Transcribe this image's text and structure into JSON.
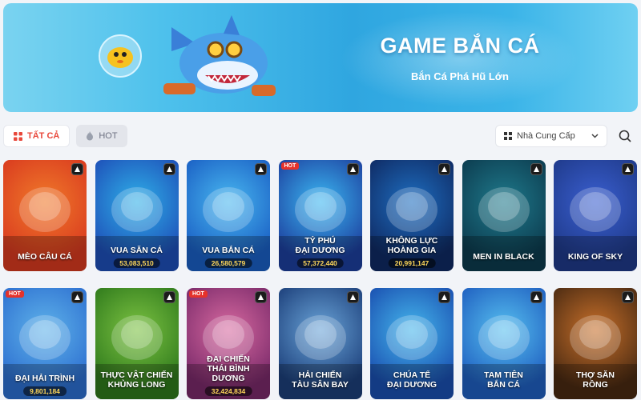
{
  "banner": {
    "title": "GAME BẮN CÁ",
    "subtitle": "Bắn Cá Phá Hũ Lớn"
  },
  "filters": [
    {
      "label": "TẤT CẢ",
      "active": true,
      "icon": "grid-icon"
    },
    {
      "label": "HOT",
      "active": false,
      "icon": "flame-icon"
    }
  ],
  "provider": {
    "label": "Nhà Cung Cấp",
    "icon": "grid-icon"
  },
  "search": {
    "icon": "search-icon"
  },
  "colors": {
    "accent": "#e8473a",
    "jackpot": "#ffd85a",
    "hot_badge": "#e5322b"
  },
  "games": [
    {
      "name": "MÈO CÂU CÁ",
      "amount": "",
      "hot": false,
      "c1": "#d93a1f",
      "c2": "#f07a2a"
    },
    {
      "name": "VUA SĂN CÁ",
      "amount": "53,083,510",
      "hot": false,
      "c1": "#1e4fb8",
      "c2": "#2fb0e8"
    },
    {
      "name": "VUA BẮN CÁ",
      "amount": "26,580,579",
      "hot": false,
      "c1": "#1a5fc4",
      "c2": "#49b8f0"
    },
    {
      "name": "TỶ PHÚ\nĐẠI DƯƠNG",
      "amount": "57,372,440",
      "hot": true,
      "c1": "#1d3f9e",
      "c2": "#3bb8f2"
    },
    {
      "name": "KHÔNG LỰC\nHOÀNG GIA",
      "amount": "20,991,147",
      "hot": false,
      "c1": "#0f2a63",
      "c2": "#1e6ec0"
    },
    {
      "name": "MEN IN BLACK",
      "amount": "",
      "hot": false,
      "c1": "#0c3b4e",
      "c2": "#1f7a8c"
    },
    {
      "name": "KING OF SKY",
      "amount": "",
      "hot": false,
      "c1": "#1f3a8a",
      "c2": "#3a5fd0"
    },
    {
      "name": "ĐẠI HẢI TRÌNH",
      "amount": "9,801,184",
      "hot": true,
      "c1": "#2d6fd0",
      "c2": "#5fb3ea"
    },
    {
      "name": "THỰC VẬT CHIẾN\nKHỦNG LONG",
      "amount": "",
      "hot": false,
      "c1": "#2f7a1c",
      "c2": "#7cc242"
    },
    {
      "name": "ĐẠI CHIẾN\nTHÁI BÌNH DƯƠNG",
      "amount": "32,424,834",
      "hot": true,
      "c1": "#7a2a6a",
      "c2": "#d86aa0"
    },
    {
      "name": "HẢI CHIẾN\nTÀU SÂN BAY",
      "amount": "",
      "hot": false,
      "c1": "#1c3f7a",
      "c2": "#6aa4d8"
    },
    {
      "name": "CHÚA TỂ\nĐẠI DƯƠNG",
      "amount": "",
      "hot": false,
      "c1": "#1a4fb0",
      "c2": "#45b6ec"
    },
    {
      "name": "TAM TIÊN\nBẮN CÁ",
      "amount": "",
      "hot": false,
      "c1": "#1f5fc0",
      "c2": "#57c0f0"
    },
    {
      "name": "THỢ SĂN\nRỒNG",
      "amount": "",
      "hot": false,
      "c1": "#4a2a12",
      "c2": "#c8702a"
    }
  ]
}
